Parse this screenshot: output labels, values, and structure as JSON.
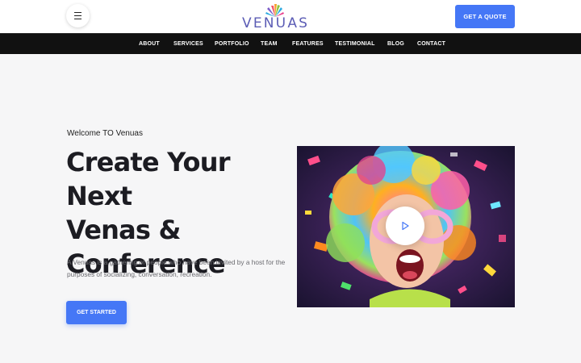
{
  "brand": {
    "name": "VENUAS",
    "logo_colors": [
      "#f2546a",
      "#f7a12c",
      "#8cc63f",
      "#29a9e0",
      "#7a5bc7",
      "#e83e8c"
    ]
  },
  "header": {
    "menu_icon": "hamburger-icon",
    "quote_label": "GET A QUOTE"
  },
  "nav": {
    "items": [
      {
        "label": "ABOUT"
      },
      {
        "label": "SERVICES"
      },
      {
        "label": "PORTFOLIO"
      },
      {
        "label": "TEAM"
      },
      {
        "label": "FEATURES"
      },
      {
        "label": "TESTIMONIAL"
      },
      {
        "label": "BLOG"
      },
      {
        "label": "CONTACT"
      }
    ]
  },
  "hero": {
    "welcome": "Welcome TO Venuas",
    "title_line1": "Create Your Next",
    "title_line2": "Venas &",
    "title_line3": "Conference",
    "description": "A Venuas is a gathering of people who have been invited by a host for the purposes of socializing, conversation, recreation.",
    "cta_label": "GET STARTED",
    "play_icon": "play-icon"
  },
  "colors": {
    "accent": "#4577f6",
    "nav_bg": "#111111",
    "page_bg": "#f6f6f7"
  }
}
